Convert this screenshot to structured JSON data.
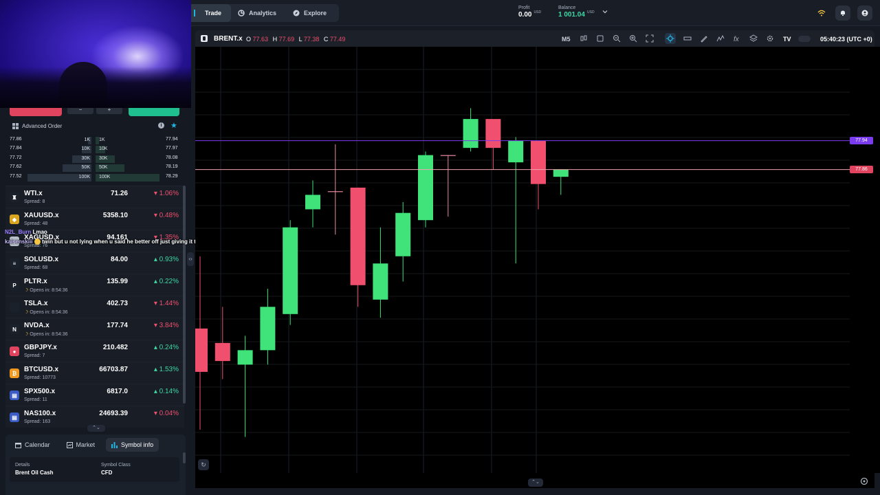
{
  "nav": {
    "tabs": [
      {
        "label": "Trade",
        "icon": "trade-icon",
        "active": true
      },
      {
        "label": "Analytics",
        "icon": "analytics-icon",
        "active": false
      },
      {
        "label": "Explore",
        "icon": "explore-icon",
        "active": false
      }
    ],
    "profit": {
      "label": "Profit",
      "value": "0.00",
      "currency": "USD"
    },
    "balance": {
      "label": "Balance",
      "value": "1 001.04",
      "currency": "USD"
    },
    "icons": [
      "wifi-icon",
      "bell-icon",
      "user-icon"
    ]
  },
  "trade_buttons": {
    "minus": "−",
    "plus": "+"
  },
  "advanced_order": {
    "title": "Advanced Order"
  },
  "depth": [
    {
      "bid": "77.86",
      "bid_qty": "1K",
      "ask_qty": "1K",
      "ask": "77.94",
      "level": 0.05
    },
    {
      "bid": "77.84",
      "bid_qty": "10K",
      "ask_qty": "10K",
      "ask": "77.97",
      "level": 0.15
    },
    {
      "bid": "77.72",
      "bid_qty": "30K",
      "ask_qty": "30K",
      "ask": "78.08",
      "level": 0.3
    },
    {
      "bid": "77.62",
      "bid_qty": "50K",
      "ask_qty": "50K",
      "ask": "78.19",
      "level": 0.45
    },
    {
      "bid": "77.52",
      "bid_qty": "100K",
      "ask_qty": "100K",
      "ask": "78.29",
      "level": 1.0
    }
  ],
  "watchlist": [
    {
      "symbol": "WTI.x",
      "sub": "Spread: 8",
      "price": "71.26",
      "change": "1.06%",
      "dir": "down",
      "logo": "oil-icon",
      "logo_color": "#1b212b",
      "logo_char": "♜"
    },
    {
      "symbol": "XAUUSD.x",
      "sub": "Spread: 48",
      "price": "5358.10",
      "change": "0.48%",
      "dir": "down",
      "logo": "gold-icon",
      "logo_color": "#d9a520",
      "logo_char": "◆"
    },
    {
      "symbol": "XAGUSD.x",
      "sub": "Spread: 76",
      "price": "94.161",
      "change": "1.35%",
      "dir": "down",
      "logo": "silver-icon",
      "logo_color": "#b9c0cc",
      "logo_char": "◆"
    },
    {
      "symbol": "SOLUSD.x",
      "sub": "Spread: 68",
      "price": "84.00",
      "change": "0.93%",
      "dir": "up",
      "logo": "solana-icon",
      "logo_color": "#1b212b",
      "logo_char": "≡"
    },
    {
      "symbol": "PLTR.x",
      "sub": "Opens in: 8:54:36",
      "price": "135.99",
      "change": "0.22%",
      "dir": "up",
      "logo": "palantir-icon",
      "logo_color": "#1b212b",
      "logo_char": "P"
    },
    {
      "symbol": "TSLA.x",
      "sub": "Opens in: 8:54:36",
      "price": "402.73",
      "change": "1.44%",
      "dir": "down",
      "logo": "tesla-icon",
      "logo_color": "#1b212b",
      "logo_char": ""
    },
    {
      "symbol": "NVDA.x",
      "sub": "Opens in: 8:54:36",
      "price": "177.74",
      "change": "3.84%",
      "dir": "down",
      "logo": "nvidia-icon",
      "logo_color": "#1b212b",
      "logo_char": "N"
    },
    {
      "symbol": "GBPJPY.x",
      "sub": "Spread: 7",
      "price": "210.482",
      "change": "0.24%",
      "dir": "up",
      "logo": "flag-icon",
      "logo_color": "#e0445e",
      "logo_char": "●"
    },
    {
      "symbol": "BTCUSD.x",
      "sub": "Spread: 10773",
      "price": "66703.87",
      "change": "1.53%",
      "dir": "up",
      "logo": "bitcoin-icon",
      "logo_color": "#f29a1f",
      "logo_char": "₿"
    },
    {
      "symbol": "SPX500.x",
      "sub": "Spread: 11",
      "price": "6817.0",
      "change": "0.14%",
      "dir": "up",
      "logo": "us-flag-icon",
      "logo_color": "#3b5cc4",
      "logo_char": "▤"
    },
    {
      "symbol": "NAS100.x",
      "sub": "Spread: 163",
      "price": "24693.39",
      "change": "0.04%",
      "dir": "down",
      "logo": "us-flag-icon",
      "logo_color": "#3b5cc4",
      "logo_char": "▤"
    }
  ],
  "chat": {
    "line1_name": "N2L_Burn",
    "line1_msg": "Lmao",
    "line2_name": "kaisenskiii",
    "line2_msg": "twin but u not lying when u said he better off just giving it to me"
  },
  "bottom_tabs": [
    {
      "label": "Calendar",
      "icon": "calendar-icon",
      "active": false
    },
    {
      "label": "Market",
      "icon": "market-icon",
      "active": false
    },
    {
      "label": "Symbol info",
      "icon": "symbol-info-icon",
      "active": true
    }
  ],
  "symbol_info": {
    "details_label": "Details",
    "details_value": "Brent Oil Cash",
    "class_label": "Symbol Class",
    "class_value": "CFD"
  },
  "chart_header": {
    "symbol": "BRENT.x",
    "o_label": "O",
    "o": "77.63",
    "h_label": "H",
    "h": "77.69",
    "l_label": "L",
    "l": "77.38",
    "c_label": "C",
    "c": "77.49",
    "timeframe": "M5",
    "clock": "05:40:23 (UTC +0)",
    "tools": [
      "candles-icon",
      "rectangle-icon",
      "zoom-out-icon",
      "zoom-in-icon",
      "fullscreen-icon",
      "crosshair-icon",
      "horizontal-line-icon",
      "pencil-icon",
      "indicator-icon",
      "fx-icon",
      "layers-icon",
      "settings-icon",
      "tradingview-icon"
    ]
  },
  "price_tags": {
    "ask": "77.94",
    "bid": "77.86",
    "ask_color": "#7b3cf0",
    "bid_color": "#e0445e"
  },
  "colors": {
    "up": "#3fe37a",
    "down": "#f0506e",
    "accent": "#1fb6e0"
  },
  "chart_data": {
    "type": "candlestick",
    "candles": [
      {
        "o": 77.3,
        "h": 77.62,
        "l": 77.14,
        "c": 77.42,
        "dir": "down"
      },
      {
        "o": 77.38,
        "h": 77.48,
        "l": 77.28,
        "c": 77.33,
        "dir": "down"
      },
      {
        "o": 77.32,
        "h": 77.4,
        "l": 77.12,
        "c": 77.36,
        "dir": "up"
      },
      {
        "o": 77.36,
        "h": 77.53,
        "l": 77.32,
        "c": 77.48,
        "dir": "up"
      },
      {
        "o": 77.46,
        "h": 77.72,
        "l": 77.43,
        "c": 77.7,
        "dir": "up"
      },
      {
        "o": 77.75,
        "h": 77.83,
        "l": 77.7,
        "c": 77.79,
        "dir": "up"
      },
      {
        "o": 77.8,
        "h": 77.93,
        "l": 77.68,
        "c": 77.8,
        "dir": "flat"
      },
      {
        "o": 77.81,
        "h": 77.81,
        "l": 77.48,
        "c": 77.54,
        "dir": "down"
      },
      {
        "o": 77.5,
        "h": 77.7,
        "l": 77.45,
        "c": 77.6,
        "dir": "up"
      },
      {
        "o": 77.62,
        "h": 77.77,
        "l": 77.55,
        "c": 77.74,
        "dir": "up"
      },
      {
        "o": 77.72,
        "h": 77.91,
        "l": 77.7,
        "c": 77.9,
        "dir": "up"
      },
      {
        "o": 77.9,
        "h": 77.9,
        "l": 77.73,
        "c": 77.9,
        "dir": "flat"
      },
      {
        "o": 77.92,
        "h": 78.03,
        "l": 77.91,
        "c": 78.0,
        "dir": "up"
      },
      {
        "o": 78.0,
        "h": 77.99,
        "l": 77.86,
        "c": 77.92,
        "dir": "down"
      },
      {
        "o": 77.88,
        "h": 77.95,
        "l": 77.6,
        "c": 77.94,
        "dir": "up"
      },
      {
        "o": 77.94,
        "h": 77.93,
        "l": 77.75,
        "c": 77.82,
        "dir": "down"
      },
      {
        "o": 77.84,
        "h": 77.86,
        "l": 77.79,
        "c": 77.86,
        "dir": "up"
      }
    ],
    "ask_line": 77.94,
    "bid_line": 77.86,
    "ylim": [
      77.02,
      78.2
    ]
  }
}
